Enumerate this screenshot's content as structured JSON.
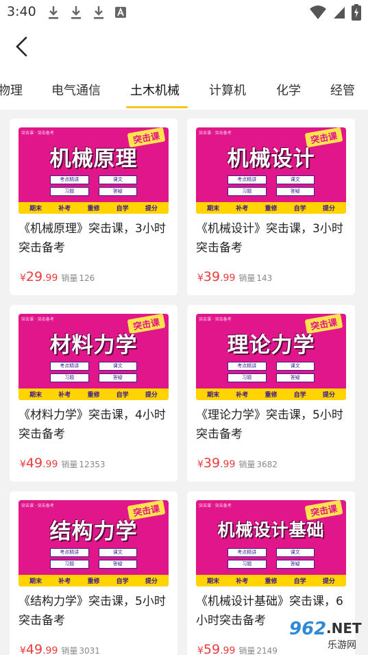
{
  "status_bar": {
    "time": "3:40",
    "icons_left": [
      "download-icon",
      "download-icon",
      "download-icon",
      "a-notification-icon"
    ],
    "icons_right": [
      "wifi-icon",
      "signal-icon",
      "battery-charging-icon"
    ]
  },
  "header": {
    "back_icon": "chevron-left-icon"
  },
  "tabs": {
    "items": [
      "物理",
      "电气通信",
      "土木机械",
      "计算机",
      "化学",
      "经管"
    ],
    "active_index": 2,
    "indicator_color": "#f5c518"
  },
  "courses": [
    {
      "title": "《机械原理》突击课，3小时突击备考",
      "thumb_title": "机械原理",
      "currency": "¥",
      "price_int": "29",
      "price_dec": ".99",
      "sales_label": "销量",
      "sales": "126"
    },
    {
      "title": "《机械设计》突击课，3小时突击备考",
      "thumb_title": "机械设计",
      "currency": "¥",
      "price_int": "39",
      "price_dec": ".99",
      "sales_label": "销量",
      "sales": "143"
    },
    {
      "title": "《材料力学》突击课，4小时突击备考",
      "thumb_title": "材料力学",
      "currency": "¥",
      "price_int": "49",
      "price_dec": ".99",
      "sales_label": "销量",
      "sales": "12353"
    },
    {
      "title": "《理论力学》突击课，5小时突击备考",
      "thumb_title": "理论力学",
      "currency": "¥",
      "price_int": "39",
      "price_dec": ".99",
      "sales_label": "销量",
      "sales": "3682"
    },
    {
      "title": "《结构力学》突击课，5小时突击备考",
      "thumb_title": "结构力学",
      "currency": "¥",
      "price_int": "49",
      "price_dec": ".99",
      "sales_label": "销量",
      "sales": "3031"
    },
    {
      "title": "《机械设计基础》突击课，6小时突击备考",
      "thumb_title": "机械设计基础",
      "currency": "¥",
      "price_int": "59",
      "price_dec": ".99",
      "sales_label": "销量",
      "sales": "2149"
    }
  ],
  "thumb_common": {
    "tag": "突击课",
    "box_labels": [
      "考点精讲",
      "课文",
      "习题",
      "答疑"
    ],
    "bottom_labels": [
      "期末",
      "补考",
      "重修",
      "自学",
      "提分"
    ],
    "accent_color": "#e0168a",
    "bar_color": "#ffd400"
  },
  "watermark": {
    "num": "962",
    "net": ".NET",
    "sub": "乐游网"
  },
  "colors": {
    "price": "#ee3a3a",
    "background": "#f2f2f2"
  }
}
